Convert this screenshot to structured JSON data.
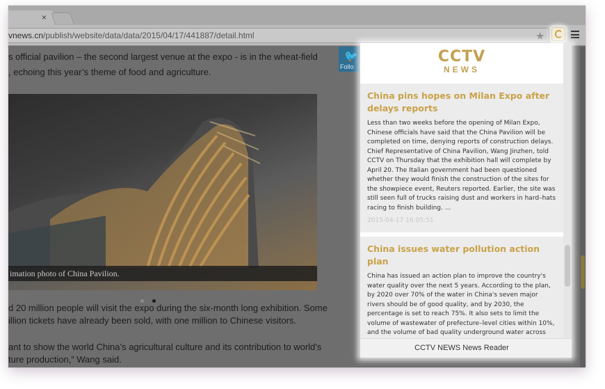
{
  "browser": {
    "url_host": "vnews.cn",
    "url_path": "/publish/website/data/data/2015/04/17/441887/detail.html",
    "tab_close": "×"
  },
  "page": {
    "para1_line1": "s official pavilion – the second largest venue at the expo - is in the wheat-field",
    "para1_line2": ", echoing this year’s theme of food and agriculture.",
    "photo_caption": "imation photo of China Pavilion.",
    "para2_line1": "d 20 million people will visit the expo during the six-month long exhibition. Some",
    "para2_line2": "illion tickets have already been sold, with one million to Chinese visitors.",
    "para3_line1": "ant to show the world China’s agricultural culture and its contribution to world’s",
    "para3_line2": "ture production,” Wang said.",
    "twitter_label": "Follo",
    "slide_dots": [
      "inactive",
      "active"
    ]
  },
  "popup": {
    "logo_top": "CCTV",
    "logo_bottom": "NEWS",
    "articles": [
      {
        "title": "China pins hopes on Milan Expo after delays reports",
        "body": "Less than two weeks before the opening of Milan Expo, Chinese officials have said that the China Pavilion will be completed on time, denying reports of construction delays. Chief Representative of China Pavilion, Wang Jinzhen, told CCTV on Thursday that the exhibition hall will complete by April 20. The Italian government had been questioned whether they would finish the construction of the sites for the showpiece event, Reuters reported. Earlier, the site was still seen full of trucks raising dust and workers in hard–hats racing to finish building. ...",
        "date": "2015-04-17 16:05:51"
      },
      {
        "title": "China issues water pollution action plan",
        "body": "China has issued an action plan to improve the country's water quality over the next 5 years. According to the plan, by 2020 over 70% of the water in China's seven major rivers should be of good quality, and by 2030, the percentage is set to reach 75%. It also sets to limit the volume of wastewater of prefecture–level cities within 10%, and the volume of bad quality underground water across the country should be limited to 15%. By 2030, over 95% of drinking water in major cities should be safe and have better quality. The plan finally",
        "date": ""
      }
    ],
    "footer": "CCTV NEWS News Reader"
  },
  "colors": {
    "accent_gold": "#c9a248",
    "dim_overlay": "#6e6e6e"
  },
  "icons": [
    "close-icon",
    "star-icon",
    "cctv-extension-icon",
    "menu-icon",
    "twitter-bird-icon"
  ]
}
